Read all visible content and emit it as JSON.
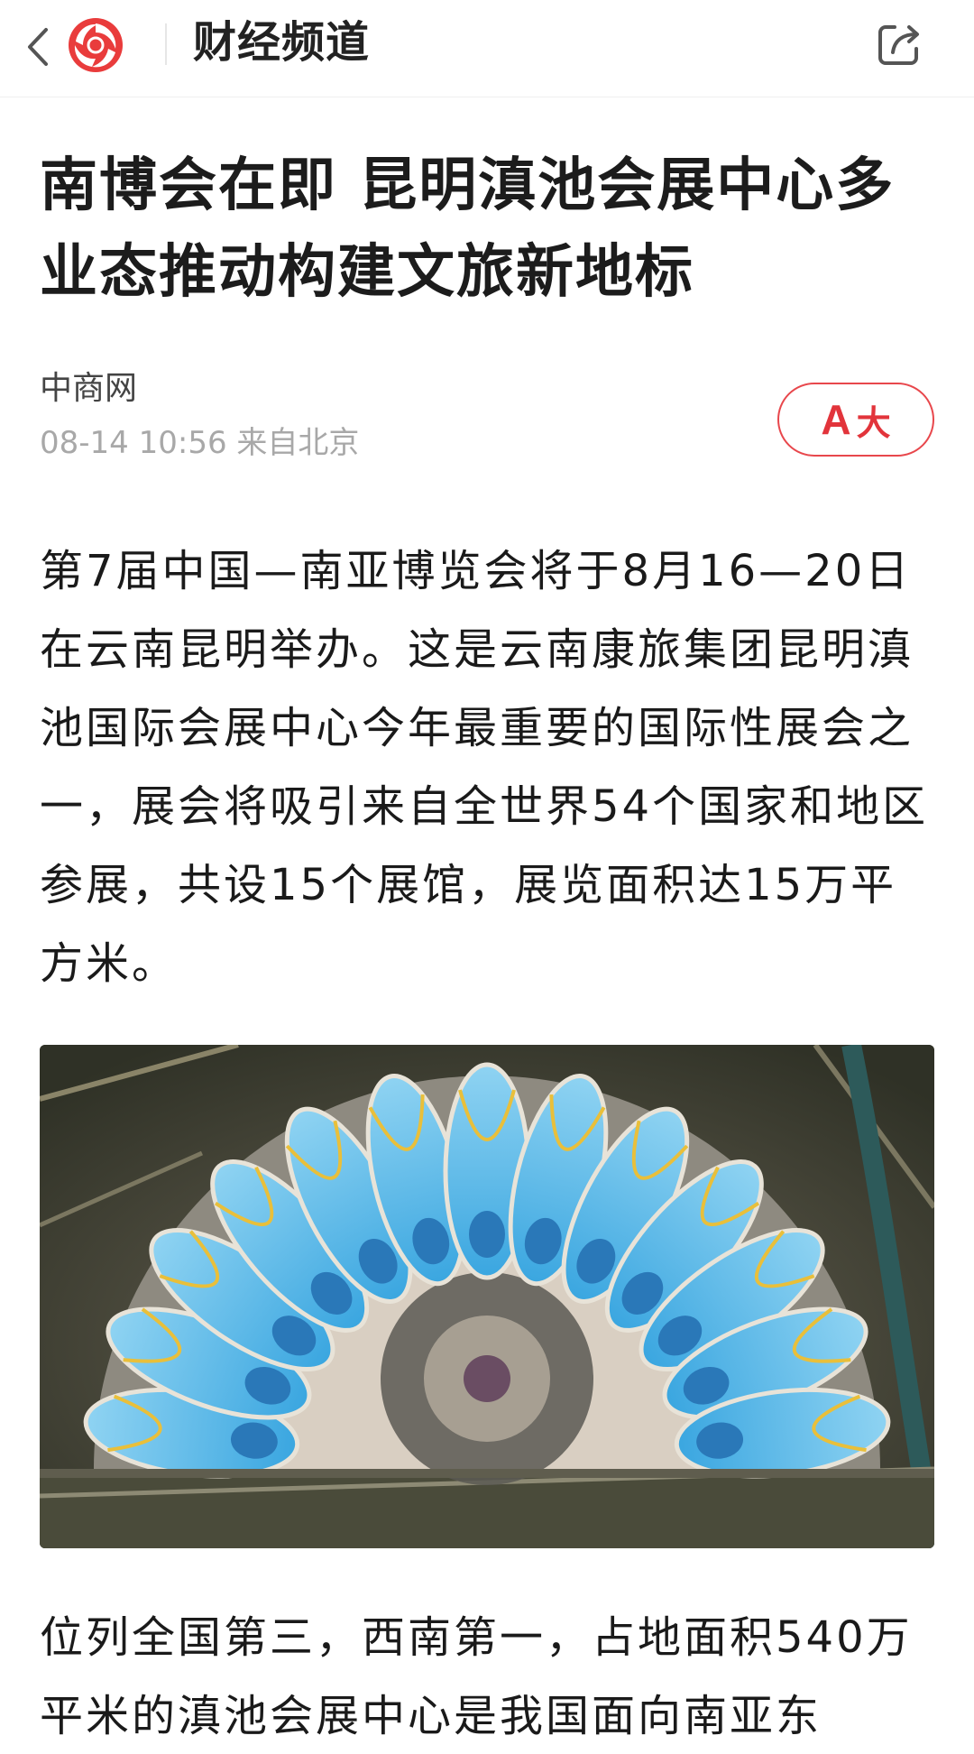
{
  "header": {
    "channel_title": "财经频道"
  },
  "article": {
    "title": "南博会在即 昆明滇池会展中心多业态推动构建文旅新地标",
    "source": "中商网",
    "meta": "08-14 10:56 来自北京",
    "font_button": {
      "a": "A",
      "da": "大"
    },
    "paragraphs": [
      "第7届中国—南亚博览会将于8月16—20日在云南昆明举办。这是云南康旅集团昆明滇池国际会展中心今年最重要的国际性展会之一，展会将吸引来自全世界54个国家和地区参展，共设15个展馆，展览面积达15万平方米。",
      "位列全国第三，西南第一，占地面积540万平米的滇池会展中心是我国面向南亚东"
    ]
  },
  "colors": {
    "accent": "#e2343b",
    "title": "#1c1c1c",
    "meta": "#a8a8a8"
  }
}
